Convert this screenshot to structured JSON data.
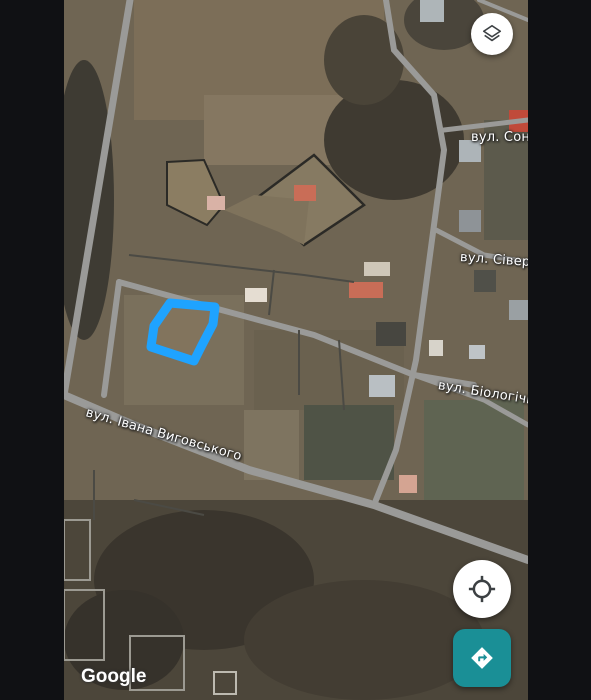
{
  "map": {
    "type": "satellite",
    "streets": {
      "sonyachna": "вул. Соня",
      "siverska": "вул. Сіверсь",
      "biologichna": "вул. Біологічна",
      "ivana_vyhovskoho": "вул. Івана Виговського"
    },
    "highlight_color": "#1fa3ff",
    "road_color": "#9a9a98"
  },
  "controls": {
    "layers_icon": "layers-icon",
    "my_location_icon": "crosshair-icon",
    "directions_icon": "directions-arrow-icon",
    "directions_color": "#1a8f96"
  },
  "attribution": {
    "logo_text": "Google"
  }
}
